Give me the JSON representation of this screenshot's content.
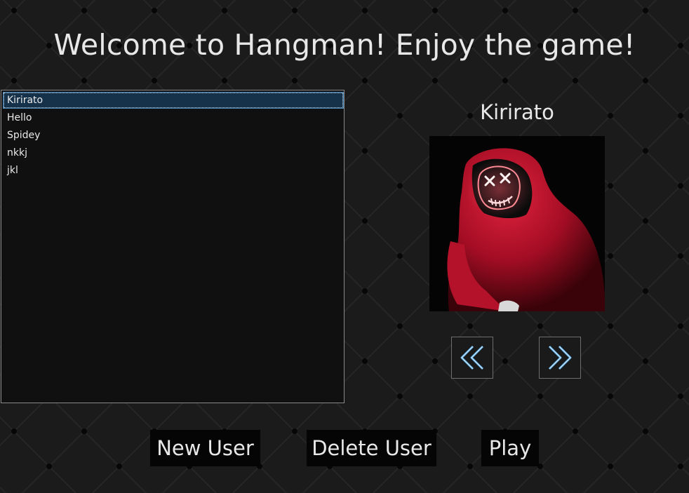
{
  "window": {
    "title": "Welcome to Hangman! Enjoy the game!"
  },
  "users": {
    "items": [
      "Kirirato",
      "Hello",
      "Spidey",
      "nkkj",
      "jkl"
    ],
    "selected_index": 0
  },
  "profile": {
    "name": "Kirirato",
    "avatar_icon": "hooded-figure-neon-mask-image"
  },
  "navigation": {
    "prev_icon": "double-chevron-left-icon",
    "next_icon": "double-chevron-right-icon"
  },
  "actions": {
    "new_user": "New User",
    "delete_user": "Delete User",
    "play": "Play"
  },
  "colors": {
    "background": "#1b1b1b",
    "accent": "#5aa9e6",
    "selection": "#15324a",
    "hood": "#c8102e"
  }
}
